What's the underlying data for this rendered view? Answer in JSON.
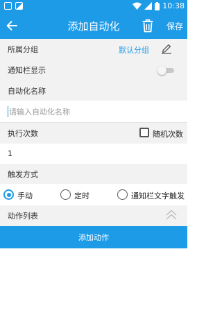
{
  "status_bar": {
    "time": "10:38"
  },
  "app_bar": {
    "title": "添加自动化",
    "save_label": "保存"
  },
  "form": {
    "group": {
      "label": "所属分组",
      "value": "默认分组"
    },
    "notification": {
      "label": "通知栏显示",
      "enabled": false
    },
    "name": {
      "label": "自动化名称",
      "placeholder": "请输入自动化名称",
      "value": ""
    },
    "exec_count": {
      "label": "执行次数",
      "random_label": "随机次数",
      "random_checked": false,
      "value": "1"
    },
    "trigger": {
      "label": "触发方式",
      "options": [
        {
          "label": "手动",
          "selected": true
        },
        {
          "label": "定时",
          "selected": false
        },
        {
          "label": "通知栏文字触发",
          "selected": false
        }
      ]
    },
    "actions": {
      "label": "动作列表",
      "add_label": "添加动作"
    }
  },
  "colors": {
    "primary": "#1E9BE7",
    "section_bg": "#F2F2F2"
  }
}
